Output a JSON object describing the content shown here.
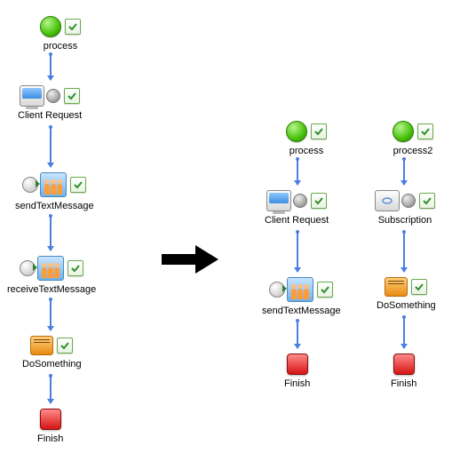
{
  "left_flow": {
    "nodes": [
      {
        "id": "process",
        "label": "process"
      },
      {
        "id": "client_request",
        "label": "Client Request"
      },
      {
        "id": "send_text",
        "label": "sendTextMessage"
      },
      {
        "id": "receive_text",
        "label": "receiveTextMessage"
      },
      {
        "id": "do_something",
        "label": "DoSomething"
      },
      {
        "id": "finish",
        "label": "Finish"
      }
    ]
  },
  "right_flow_a": {
    "nodes": [
      {
        "id": "process",
        "label": "process"
      },
      {
        "id": "client_request",
        "label": "Client Request"
      },
      {
        "id": "send_text",
        "label": "sendTextMessage"
      },
      {
        "id": "finish",
        "label": "Finish"
      }
    ]
  },
  "right_flow_b": {
    "nodes": [
      {
        "id": "process2",
        "label": "process2"
      },
      {
        "id": "subscription",
        "label": "Subscription"
      },
      {
        "id": "do_something",
        "label": "DoSomething"
      },
      {
        "id": "finish",
        "label": "Finish"
      }
    ]
  },
  "icons": {
    "process": "process-circle",
    "client_request": "client-request-icon",
    "send_text": "send-message-icon",
    "receive_text": "receive-message-icon",
    "do_something": "activity-icon",
    "finish": "finish-icon",
    "subscription": "subscription-icon"
  }
}
